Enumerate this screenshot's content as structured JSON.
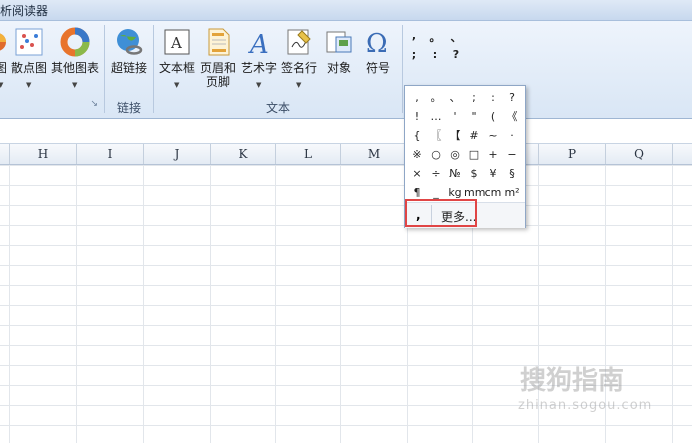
{
  "title": "析阅读器",
  "ribbon": {
    "buttons": [
      {
        "label": "图",
        "icon": "chart-icon"
      },
      {
        "label": "散点图",
        "icon": "scatter-chart-icon"
      },
      {
        "label": "其他图表",
        "icon": "donut-chart-icon"
      },
      {
        "label": "超链接",
        "icon": "globe-link-icon"
      },
      {
        "label": "文本框",
        "icon": "textbox-icon"
      },
      {
        "label": "页眉和",
        "label2": "页脚",
        "icon": "header-footer-icon"
      },
      {
        "label": "艺术字",
        "icon": "wordart-icon"
      },
      {
        "label": "签名行",
        "icon": "signature-icon"
      },
      {
        "label": "对象",
        "icon": "object-icon"
      },
      {
        "label": "符号",
        "icon": "omega-icon"
      }
    ],
    "groups": {
      "link": "链接",
      "text": "文本"
    },
    "symbol_preview": [
      ",",
      "。",
      "、",
      ";",
      ":",
      "?"
    ],
    "symbol_button": "符号"
  },
  "columns": [
    "H",
    "I",
    "J",
    "K",
    "L",
    "M",
    "",
    "P",
    "Q"
  ],
  "dropdown": {
    "rows": [
      [
        ",",
        "。",
        "、",
        ";",
        ":",
        "?"
      ],
      [
        "!",
        "…",
        "'",
        "\"",
        "(",
        "《"
      ],
      [
        "{",
        "〖",
        "【",
        "#",
        "~",
        "·"
      ],
      [
        "※",
        "○",
        "◎",
        "□",
        "+",
        "−"
      ],
      [
        "×",
        "÷",
        "№",
        "$",
        "¥",
        "§"
      ],
      [
        "¶",
        "_",
        "kg",
        "mm",
        "cm",
        "m²"
      ]
    ],
    "recent_symbol": ",",
    "more_label": "更多..."
  },
  "watermark": {
    "line1": "搜狗指南",
    "line2": "zhinan.sogou.com"
  }
}
